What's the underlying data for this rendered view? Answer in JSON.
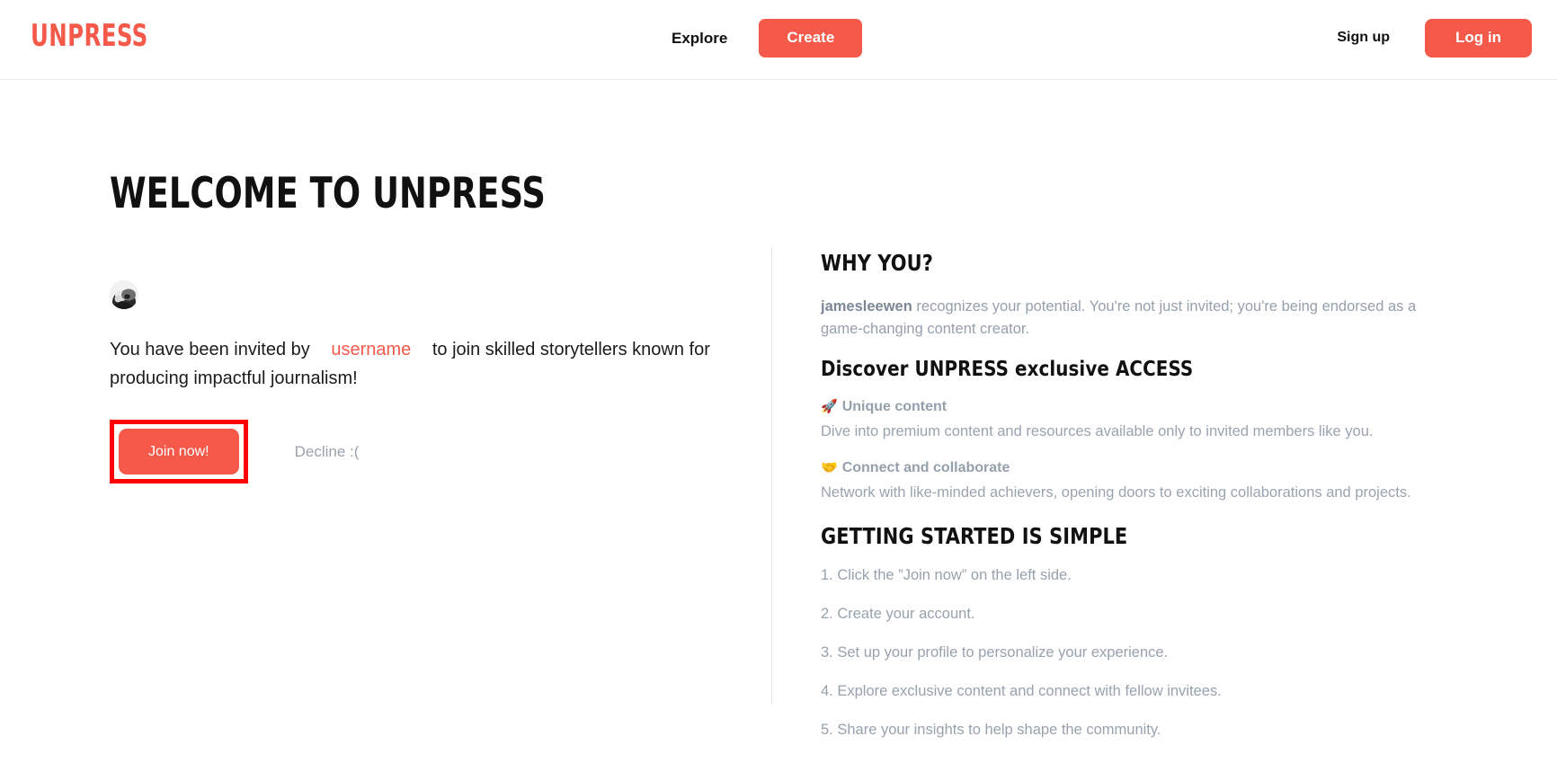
{
  "navbar": {
    "logo": "UNPRESS",
    "explore_label": "Explore",
    "create_label": "Create",
    "signup_label": "Sign up",
    "login_label": "Log in",
    "accent_color": "#f4594a"
  },
  "left": {
    "title": "WELCOME TO UNPRESS",
    "avatar_icon": "user-photo-avatar",
    "invite_prefix": "You have been invited by",
    "invite_username": "username",
    "invite_suffix": "to join skilled storytellers known for producing impactful journalism!",
    "join_label": "Join now!",
    "decline_label": "Decline :(",
    "annotation_color": "#ff0000"
  },
  "right": {
    "why_heading": "WHY YOU?",
    "why_username": "jamesleewen",
    "why_body": " recognizes your potential. You're not just invited; you're being endorsed as a game-changing content creator.",
    "discover_heading": "Discover UNPRESS exclusive ACCESS",
    "features": [
      {
        "emoji": "🚀",
        "icon_name": "rocket-icon",
        "title": "Unique content",
        "desc": "Dive into premium content and resources available only to invited members like you."
      },
      {
        "emoji": "🤝",
        "icon_name": "handshake-icon",
        "title": "Connect and collaborate",
        "desc": "Network with like-minded achievers, opening doors to exciting collaborations and projects."
      }
    ],
    "getting_started_heading": "GETTING STARTED IS SIMPLE",
    "steps": [
      "1. Click the ”Join now” on the left side.",
      "2. Create your account.",
      "3. Set up your profile to personalize your experience.",
      "4. Explore exclusive content and connect with fellow invitees.",
      "5. Share your insights to help shape the community."
    ]
  }
}
